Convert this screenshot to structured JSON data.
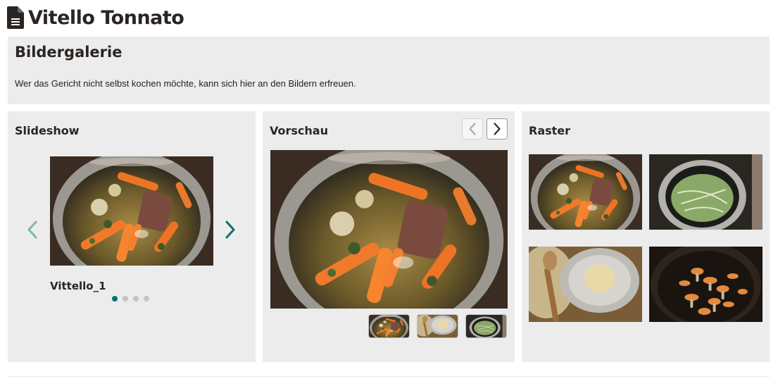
{
  "page": {
    "title": "Vitello Tonnato"
  },
  "intro": {
    "heading": "Bildergalerie",
    "text": "Wer das Gericht nicht selbst kochen möchte, kann sich hier an den Bildern erfreuen."
  },
  "slideshow": {
    "title": "Slideshow",
    "caption": "Vittello_1",
    "dot_count": 4,
    "active_dot": 1
  },
  "preview": {
    "title": "Vorschau"
  },
  "grid": {
    "title": "Raster"
  },
  "colors": {
    "accent": "#0e6e6e",
    "panel_bg": "#ececec",
    "title_text": "#2b2522"
  },
  "icons": {
    "page_icon": "document-icon",
    "prev": "chevron-left-icon",
    "next": "chevron-right-icon"
  }
}
